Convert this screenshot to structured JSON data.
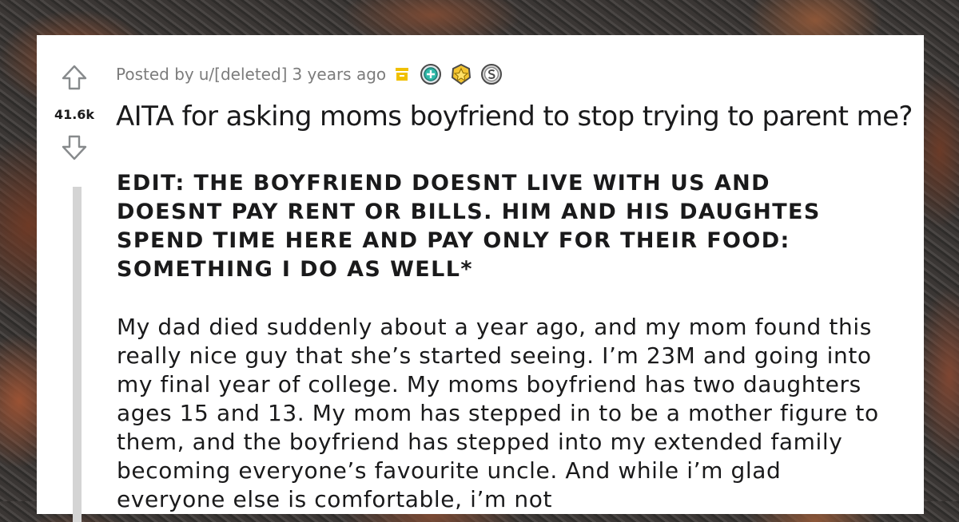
{
  "post": {
    "vote_score": "41.6k",
    "meta": {
      "posted_by_prefix": "Posted by",
      "author": "u/[deleted]",
      "age": "3 years ago",
      "archive_icon": "archive-box-icon",
      "awards": [
        "helpful-award-icon",
        "wholesome-award-icon",
        "silver-award-icon"
      ]
    },
    "title": "AITA for asking moms boyfriend to stop trying to parent me?",
    "edit_text": "EDIT: THE BOYFRIEND DOESNT LIVE WITH US AND DOESNT PAY RENT OR BILLS. HIM AND HIS DAUGHTES SPEND TIME HERE AND PAY ONLY FOR THEIR FOOD: SOMETHING I DO AS WELL*",
    "body_text": "My dad died suddenly about a year ago, and my mom found this really nice guy that she’s started seeing. I’m 23M and going into my final year of college. My moms boyfriend has two daughters ages 15 and 13. My mom has stepped in to be a mother figure to them, and the boyfriend has stepped into my extended family becoming everyone’s favourite uncle. And while i’m glad everyone else is comfortable, i’m not"
  },
  "colors": {
    "text": "#1a1a1b",
    "meta": "#7c7c7c",
    "thread_line": "#d4d4d4",
    "archive": "#f0c000"
  }
}
